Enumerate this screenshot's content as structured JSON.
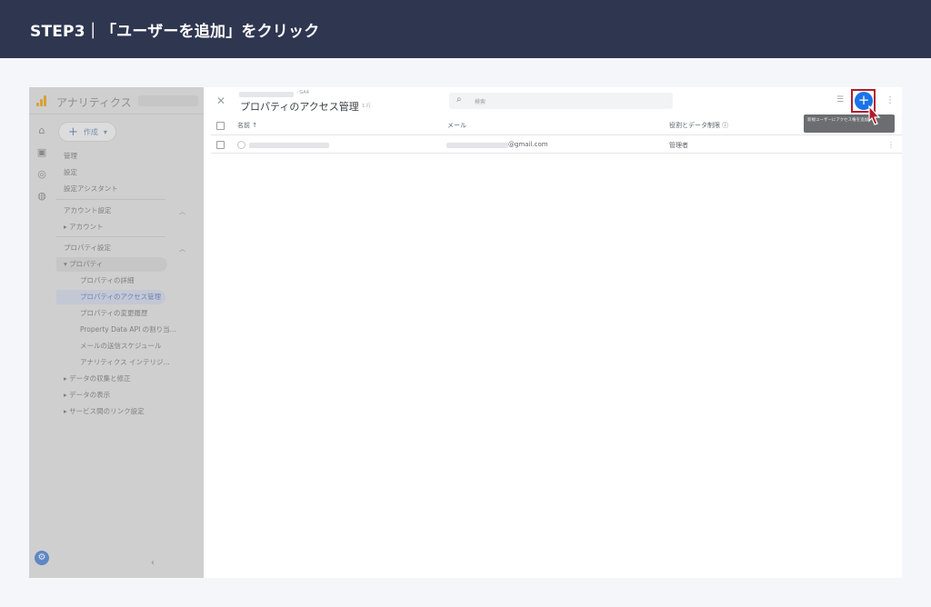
{
  "banner": {
    "title": "STEP3｜「ユーザーを追加」をクリック"
  },
  "sidebar": {
    "app_title": "アナリティクス",
    "create_label": "作成",
    "items": {
      "admin": "管理",
      "settings": "設定",
      "setup_assistant": "設定アシスタント",
      "account_settings": "アカウント設定",
      "account": "アカウント",
      "property_settings": "プロパティ設定",
      "property": "プロパティ",
      "property_details": "プロパティの詳細",
      "property_access": "プロパティのアクセス管理",
      "property_history": "プロパティの変更履歴",
      "data_api": "Property Data API の割り当...",
      "email_schedule": "メールの送信スケジュール",
      "analytics_insights": "アナリティクス インテリジ...",
      "data_collection": "データの収集と修正",
      "data_display": "データの表示",
      "service_links": "サービス間のリンク設定"
    }
  },
  "header": {
    "breadcrumb_tail": "- GA4",
    "title": "プロパティのアクセス管理",
    "title_sub": "1 行",
    "search_placeholder": "検索",
    "add_button": "+",
    "tooltip": "新規ユーザーにアクセス権を追加"
  },
  "table": {
    "headers": {
      "name": "名前 ↑",
      "email": "メール",
      "role": "役割とデータ制限 ⓘ"
    },
    "rows": [
      {
        "email_suffix": "@gmail.com",
        "role": "管理者"
      }
    ]
  },
  "colors": {
    "banner": "#2f3650",
    "accent": "#1a73e8",
    "highlight": "#b01c2e"
  }
}
